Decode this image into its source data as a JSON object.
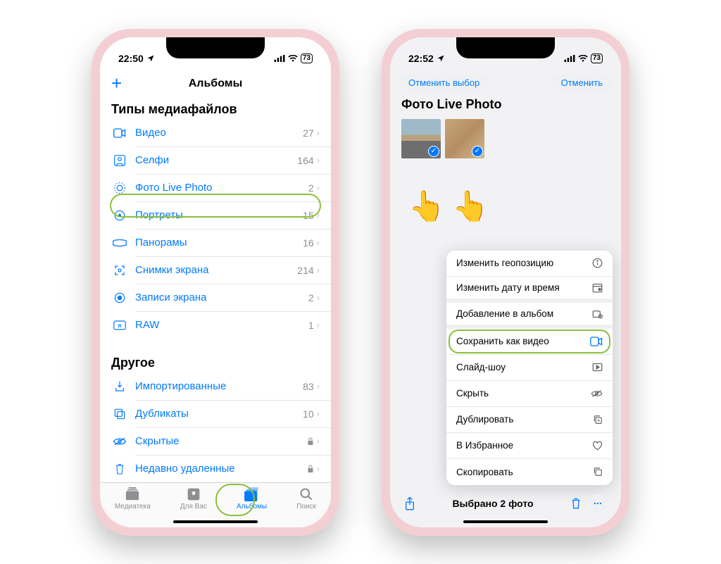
{
  "phone1": {
    "status": {
      "time": "22:50",
      "battery": "73"
    },
    "nav_title": "Альбомы",
    "section1": "Типы медиафайлов",
    "media_types": [
      {
        "icon": "video-icon",
        "label": "Видео",
        "count": "27"
      },
      {
        "icon": "selfie-icon",
        "label": "Селфи",
        "count": "164"
      },
      {
        "icon": "livephoto-icon",
        "label": "Фото Live Photo",
        "count": "2",
        "highlight": true
      },
      {
        "icon": "portrait-icon",
        "label": "Портреты",
        "count": "15"
      },
      {
        "icon": "panorama-icon",
        "label": "Панорамы",
        "count": "16"
      },
      {
        "icon": "screenshot-icon",
        "label": "Снимки экрана",
        "count": "214"
      },
      {
        "icon": "screenrec-icon",
        "label": "Записи экрана",
        "count": "2"
      },
      {
        "icon": "raw-icon",
        "label": "RAW",
        "count": "1"
      }
    ],
    "section2": "Другое",
    "others": [
      {
        "icon": "imported-icon",
        "label": "Импортированные",
        "count": "83"
      },
      {
        "icon": "duplicate-icon",
        "label": "Дубликаты",
        "count": "10"
      },
      {
        "icon": "hidden-icon",
        "label": "Скрытые",
        "locked": true
      },
      {
        "icon": "trash-icon",
        "label": "Недавно удаленные",
        "locked": true
      }
    ],
    "tabs": [
      {
        "label": "Медиатека"
      },
      {
        "label": "Для Вас"
      },
      {
        "label": "Альбомы",
        "active": true,
        "highlight": true
      },
      {
        "label": "Поиск"
      }
    ]
  },
  "phone2": {
    "status": {
      "time": "22:52",
      "battery": "73"
    },
    "deselect": "Отменить выбор",
    "cancel": "Отменить",
    "title": "Фото Live Photo",
    "menu": [
      {
        "label": "Изменить геопозицию",
        "icon": "info-icon"
      },
      {
        "label": "Изменить дату и время",
        "icon": "calendar-icon",
        "thick": true
      },
      {
        "label": "Добавление в альбом",
        "icon": "addalbum-icon",
        "thick": true
      },
      {
        "label": "Сохранить как видео",
        "icon": "video-icon",
        "highlight": true
      },
      {
        "label": "Слайд-шоу",
        "icon": "play-icon"
      },
      {
        "label": "Скрыть",
        "icon": "eye-icon"
      },
      {
        "label": "Дублировать",
        "icon": "dup-icon"
      },
      {
        "label": "В Избранное",
        "icon": "heart-icon"
      },
      {
        "label": "Скопировать",
        "icon": "copy-icon"
      }
    ],
    "selected_text": "Выбрано 2 фото"
  }
}
